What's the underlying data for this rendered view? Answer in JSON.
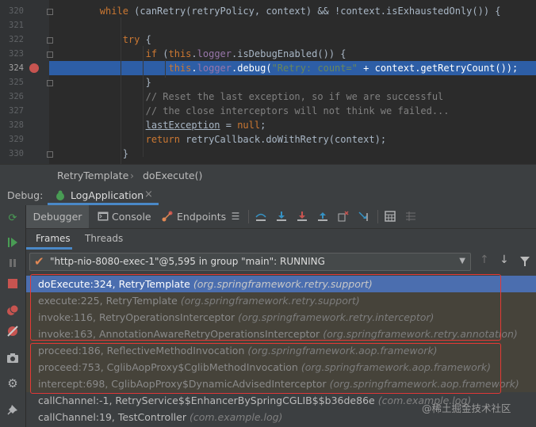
{
  "editor": {
    "lines": [
      {
        "num": "320",
        "parts": [
          {
            "t": "        "
          },
          {
            "t": "while",
            "c": "kw"
          },
          {
            "t": " (canRetry(retryPolicy, context) && !context.isExhaustedOnly()) {"
          }
        ]
      },
      {
        "num": "321",
        "parts": [
          {
            "t": ""
          }
        ]
      },
      {
        "num": "322",
        "parts": [
          {
            "t": "            "
          },
          {
            "t": "try",
            "c": "kw"
          },
          {
            "t": " {"
          }
        ]
      },
      {
        "num": "323",
        "parts": [
          {
            "t": "                "
          },
          {
            "t": "if",
            "c": "kw"
          },
          {
            "t": " ("
          },
          {
            "t": "this",
            "c": "kw"
          },
          {
            "t": "."
          },
          {
            "t": "logger",
            "c": "fld"
          },
          {
            "t": ".isDebugEnabled()) {"
          }
        ]
      },
      {
        "num": "324",
        "current": true,
        "parts": [
          {
            "t": "                    "
          },
          {
            "t": "this",
            "c": "kw"
          },
          {
            "t": "."
          },
          {
            "t": "logger",
            "c": "fld"
          },
          {
            "t": ".debug("
          },
          {
            "t": "\"Retry: count=\"",
            "c": "str"
          },
          {
            "t": " + context.getRetryCount());"
          }
        ]
      },
      {
        "num": "325",
        "parts": [
          {
            "t": "                }"
          }
        ]
      },
      {
        "num": "326",
        "parts": [
          {
            "t": "                "
          },
          {
            "t": "// Reset the last exception, so if we are successful",
            "c": "cmt"
          }
        ]
      },
      {
        "num": "327",
        "parts": [
          {
            "t": "                "
          },
          {
            "t": "// the close interceptors will not think we failed...",
            "c": "cmt"
          }
        ]
      },
      {
        "num": "328",
        "parts": [
          {
            "t": "                "
          },
          {
            "t": "lastException",
            "c": "ul"
          },
          {
            "t": " = "
          },
          {
            "t": "null",
            "c": "kw"
          },
          {
            "t": ";"
          }
        ]
      },
      {
        "num": "329",
        "parts": [
          {
            "t": "                "
          },
          {
            "t": "return",
            "c": "kw"
          },
          {
            "t": " retryCallback.doWithRetry(context);"
          }
        ]
      },
      {
        "num": "330",
        "parts": [
          {
            "t": "            }"
          }
        ]
      }
    ]
  },
  "breadcrumb": {
    "class_name": "RetryTemplate",
    "method": "doExecute()"
  },
  "debug_bar": {
    "label": "Debug:",
    "config_tab": "LogApplication",
    "close": "×"
  },
  "tabs": {
    "debugger": "Debugger",
    "console": "Console",
    "endpoints": "Endpoints"
  },
  "subtabs": {
    "frames": "Frames",
    "threads": "Threads"
  },
  "thread_selector": {
    "value": "\"http-nio-8080-exec-1\"@5,595 in group \"main\": RUNNING"
  },
  "frames": [
    {
      "method": "doExecute:324, RetryTemplate",
      "pkg": "(org.springframework.retry.support)",
      "kind": "sel"
    },
    {
      "method": "execute:225, RetryTemplate",
      "pkg": "(org.springframework.retry.support)",
      "kind": "lib"
    },
    {
      "method": "invoke:116, RetryOperationsInterceptor",
      "pkg": "(org.springframework.retry.interceptor)",
      "kind": "lib"
    },
    {
      "method": "invoke:163, AnnotationAwareRetryOperationsInterceptor",
      "pkg": "(org.springframework.retry.annotation)",
      "kind": "lib"
    },
    {
      "method": "proceed:186, ReflectiveMethodInvocation",
      "pkg": "(org.springframework.aop.framework)",
      "kind": "lib"
    },
    {
      "method": "proceed:753, CglibAopProxy$CglibMethodInvocation",
      "pkg": "(org.springframework.aop.framework)",
      "kind": "lib"
    },
    {
      "method": "intercept:698, CglibAopProxy$DynamicAdvisedInterceptor",
      "pkg": "(org.springframework.aop.framework)",
      "kind": "lib"
    },
    {
      "method": "callChannel:-1, RetryService$$EnhancerBySpringCGLIB$$b36de86e",
      "pkg": "(com.example.log)",
      "kind": "app"
    },
    {
      "method": "callChannel:19, TestController",
      "pkg": "(com.example.log)",
      "kind": "app"
    }
  ],
  "watermark": "@稀土掘金技术社区",
  "colors": {
    "selection": "#4b6eaf",
    "library_frame_bg": "#46433a",
    "annotation_box": "#e53935",
    "breakpoint": "#c75450"
  }
}
